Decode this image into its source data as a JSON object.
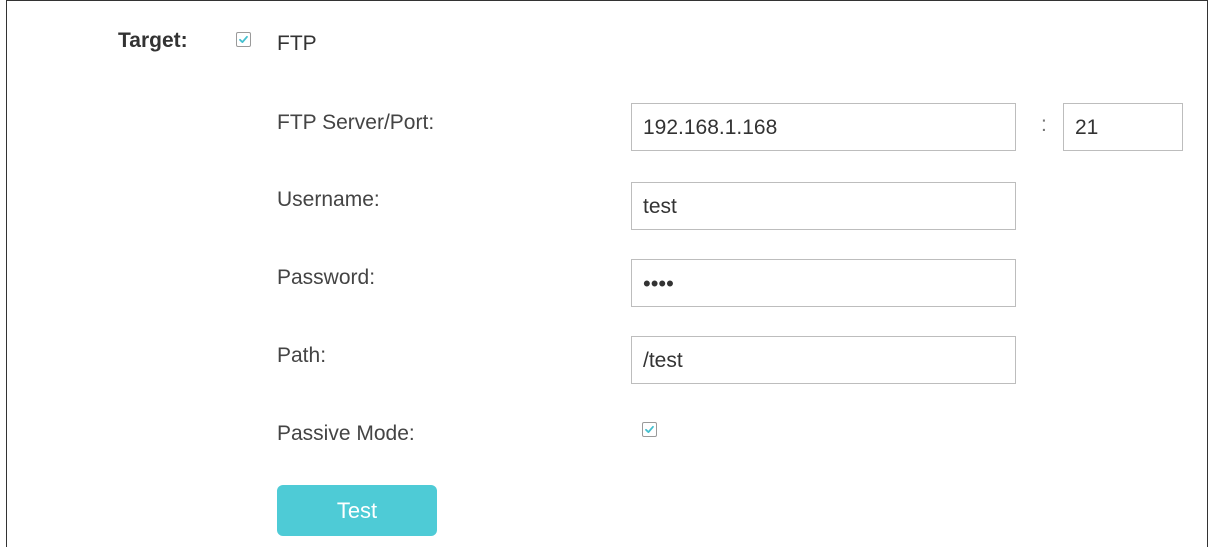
{
  "target": {
    "label": "Target:",
    "ftp_checked": true,
    "ftp_label": "FTP"
  },
  "form": {
    "server_label": "FTP Server/Port:",
    "server_value": "192.168.1.168",
    "port_separator": ":",
    "port_value": "21",
    "username_label": "Username:",
    "username_value": "test",
    "password_label": "Password:",
    "password_mask": "••••",
    "path_label": "Path:",
    "path_value": "/test",
    "passive_label": "Passive Mode:",
    "passive_checked": true
  },
  "actions": {
    "test_label": "Test"
  },
  "colors": {
    "accent": "#4ecbd6",
    "check": "#45c0cf"
  }
}
